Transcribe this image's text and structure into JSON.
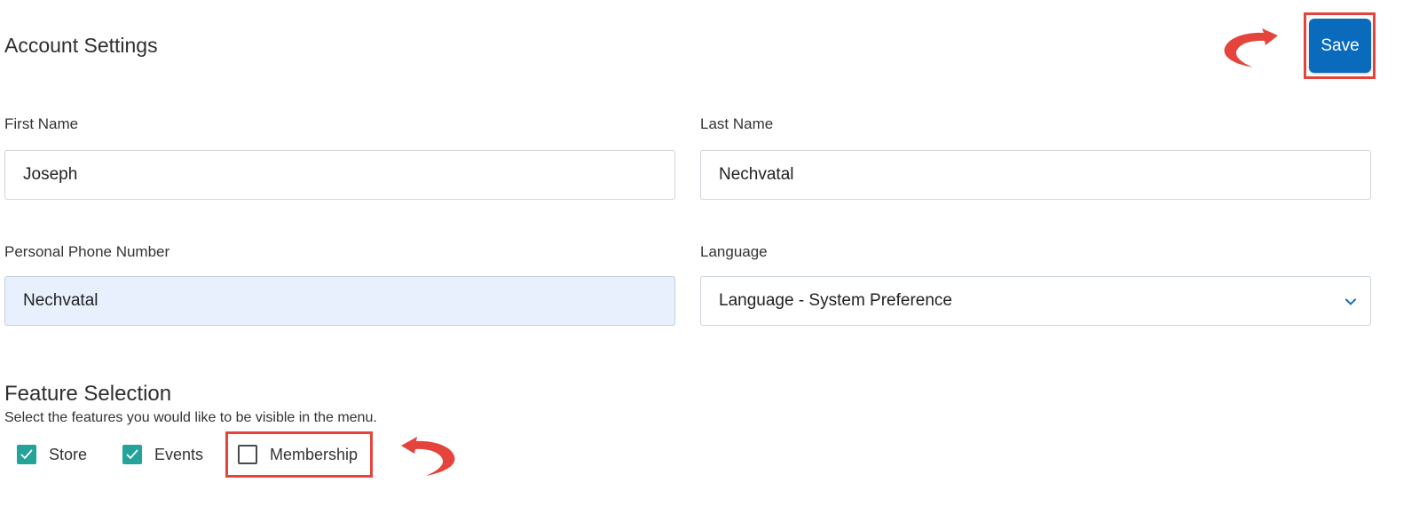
{
  "header": {
    "title": "Account Settings",
    "save_label": "Save"
  },
  "form": {
    "first_name": {
      "label": "First Name",
      "value": "Joseph"
    },
    "last_name": {
      "label": "Last Name",
      "value": "Nechvatal"
    },
    "phone": {
      "label": "Personal Phone Number",
      "value": "Nechvatal"
    },
    "language": {
      "label": "Language",
      "value": "Language - System Preference"
    }
  },
  "features": {
    "title": "Feature Selection",
    "description": "Select the features you would like to be visible in the menu.",
    "items": [
      {
        "label": "Store",
        "checked": true
      },
      {
        "label": "Events",
        "checked": true
      },
      {
        "label": "Membership",
        "checked": false
      }
    ]
  },
  "colors": {
    "primary": "#0a6bbd",
    "checkbox_on": "#23a39a",
    "annotation": "#e4443c",
    "autofill_bg": "#e8f0fe"
  },
  "icons": {
    "annotation_arrows": "curved-arrow-icon",
    "select": "chevron-down-icon",
    "checkmark": "check-icon"
  }
}
